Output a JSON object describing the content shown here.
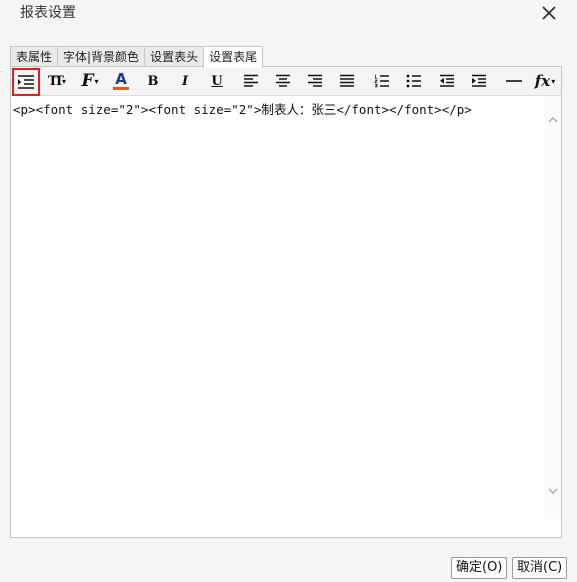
{
  "dialog": {
    "title": "报表设置"
  },
  "tabs": [
    {
      "label": "表属性"
    },
    {
      "label": "字体|背景颜色"
    },
    {
      "label": "设置表头"
    },
    {
      "label": "设置表尾"
    }
  ],
  "toolbar": {
    "buttons": [
      {
        "name": "source-code",
        "icon": "source-view-icon"
      },
      {
        "name": "font-size",
        "label": "TT",
        "icon": "font-size-icon"
      },
      {
        "name": "font-family",
        "label": "F",
        "icon": "font-family-icon"
      },
      {
        "name": "font-color",
        "label": "A",
        "icon": "font-color-icon",
        "underline_color": "#e05a1a"
      },
      {
        "name": "bold",
        "label": "B",
        "icon": "bold-icon"
      },
      {
        "name": "italic",
        "label": "I",
        "icon": "italic-icon"
      },
      {
        "name": "underline",
        "label": "U",
        "icon": "underline-icon"
      },
      {
        "name": "align-left",
        "icon": "align-left-icon"
      },
      {
        "name": "align-center",
        "icon": "align-center-icon"
      },
      {
        "name": "align-right",
        "icon": "align-right-icon"
      },
      {
        "name": "justify",
        "icon": "justify-icon"
      },
      {
        "name": "ordered-list",
        "icon": "ordered-list-icon"
      },
      {
        "name": "unordered-list",
        "icon": "unordered-list-icon"
      },
      {
        "name": "outdent",
        "icon": "outdent-icon"
      },
      {
        "name": "indent",
        "icon": "indent-icon"
      },
      {
        "name": "horizontal-rule",
        "icon": "horizontal-rule-icon"
      },
      {
        "name": "function",
        "label": "fx",
        "icon": "function-icon"
      }
    ],
    "selected": "source-code",
    "selected_color": "#e02020"
  },
  "editor": {
    "content": "<p><font size=\"2\"><font size=\"2\">制表人：张三</font></font></p>"
  },
  "footer": {
    "ok_label": "确定(O)",
    "cancel_label": "取消(C)"
  }
}
